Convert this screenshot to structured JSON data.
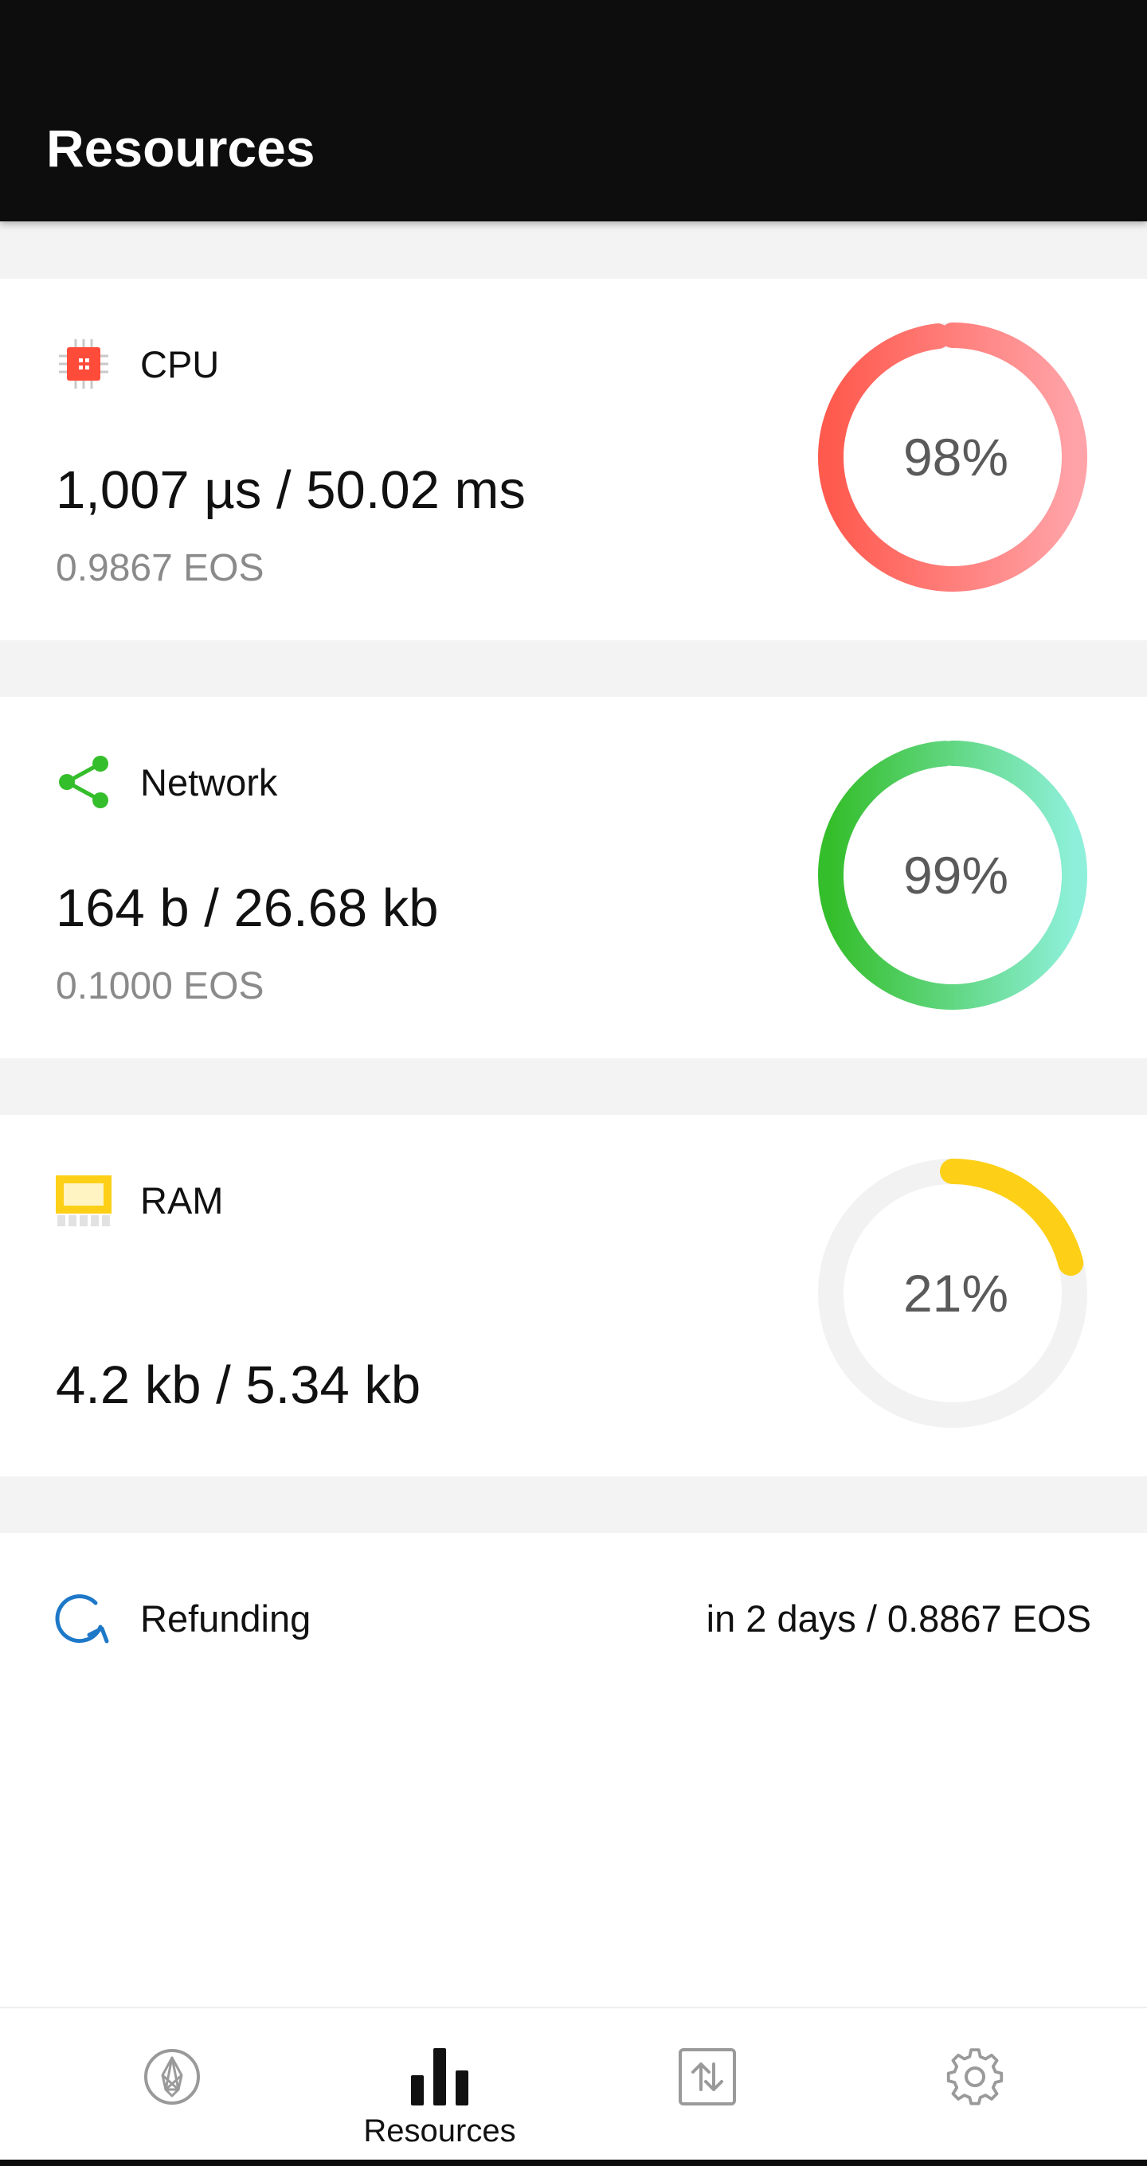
{
  "header": {
    "title": "Resources"
  },
  "resources": [
    {
      "label": "CPU",
      "amount": "1,007 µs / 50.02 ms",
      "cost": "0.9867 EOS",
      "percent_text": "98%",
      "percent": 98,
      "icon": "cpu-chip-icon",
      "color_start": "#ff5a4e",
      "color_end": "#ffa3a8"
    },
    {
      "label": "Network",
      "amount": "164 b / 26.68 kb",
      "cost": "0.1000 EOS",
      "percent_text": "99%",
      "percent": 99,
      "icon": "share-network-icon",
      "color_start": "#35be2b",
      "color_end": "#8ef0da"
    },
    {
      "label": "RAM",
      "amount": "4.2 kb / 5.34 kb",
      "cost": "",
      "percent_text": "21%",
      "percent": 21,
      "icon": "ram-memory-icon",
      "color_start": "#fdd017",
      "color_end": "#fdd017"
    }
  ],
  "refunding": {
    "label": "Refunding",
    "value": "in 2 days / 0.8867 EOS",
    "icon": "refresh-icon",
    "color": "#1e78c8"
  },
  "bottom_nav": {
    "active": "Resources",
    "items": [
      {
        "icon": "eos-logo-icon",
        "label": ""
      },
      {
        "icon": "bar-chart-icon",
        "label": "Resources"
      },
      {
        "icon": "transfer-arrows-icon",
        "label": ""
      },
      {
        "icon": "gear-icon",
        "label": ""
      }
    ]
  },
  "colors": {
    "header_bg": "#0d0d0d",
    "page_bg": "#f3f3f3",
    "gauge_track": "#f2f2f2"
  }
}
